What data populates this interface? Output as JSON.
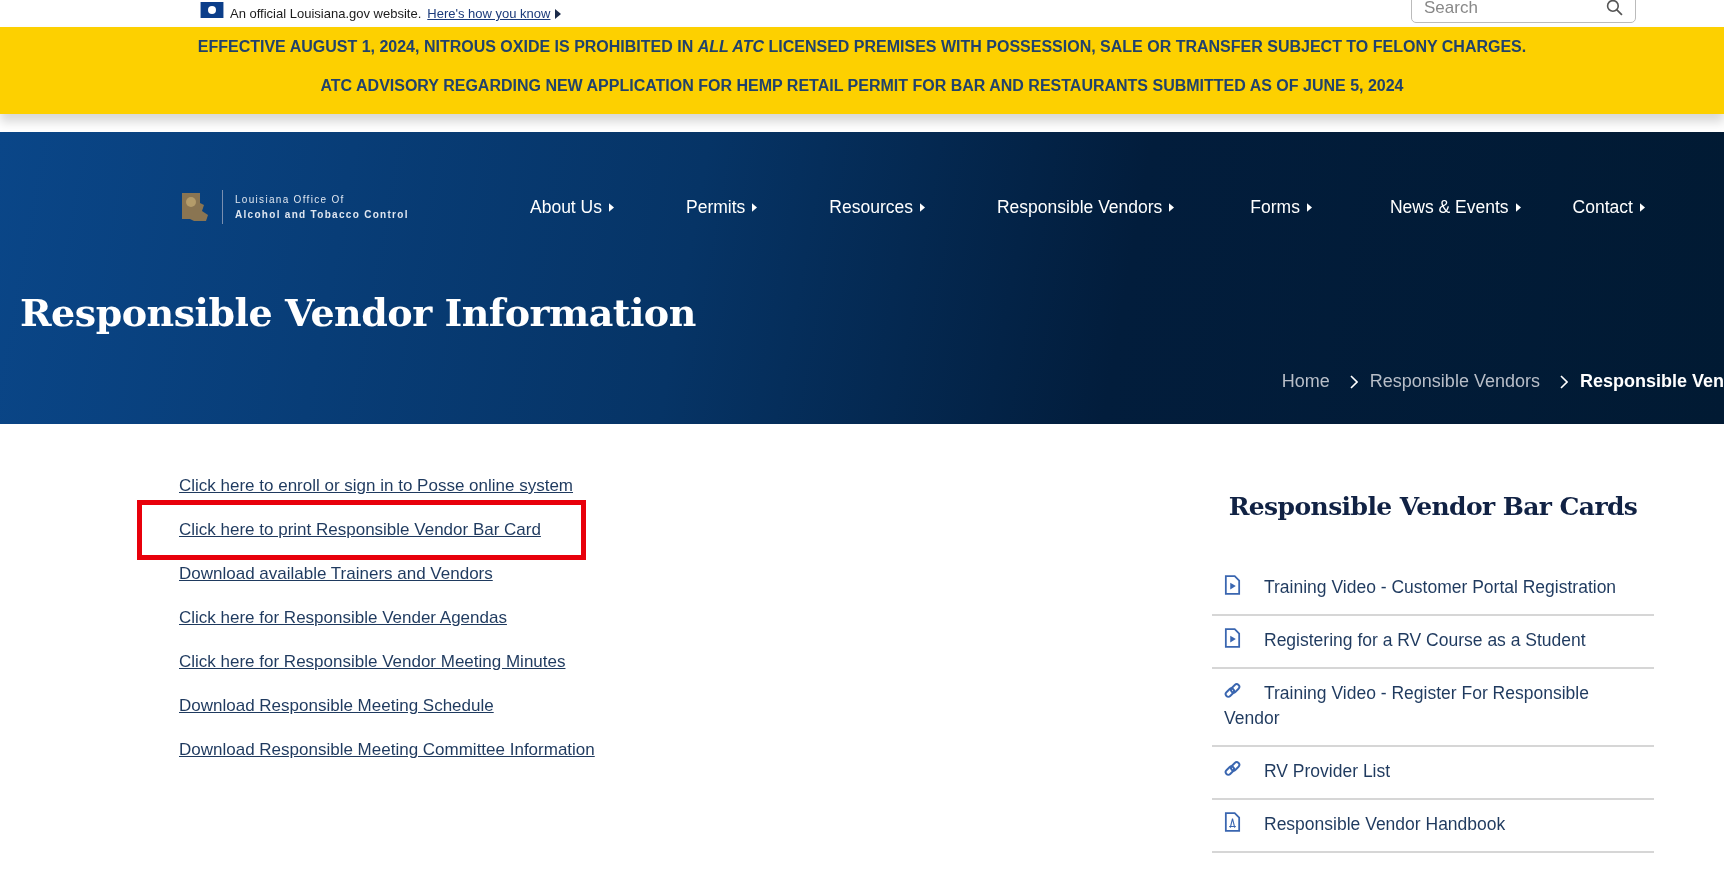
{
  "gov_bar": {
    "text": "An official Louisiana.gov website.",
    "link": "Here's how you know",
    "search": {
      "placeholder": "Search"
    }
  },
  "alerts": [
    "EFFECTIVE AUGUST 1, 2024, NITROUS OXIDE IS PROHIBITED IN *ALL ATC* LICENSED PREMISES WITH POSSESSION, SALE OR TRANSFER SUBJECT TO FELONY CHARGES.",
    "ATC ADVISORY REGARDING NEW APPLICATION FOR HEMP RETAIL PERMIT FOR BAR AND RESTAURANTS SUBMITTED AS OF JUNE 5, 2024"
  ],
  "logo": {
    "line_1": "Louisiana Office Of",
    "line_2": "Alcohol and Tobacco Control"
  },
  "nav": [
    "About Us",
    "Permits",
    "Resources",
    "Responsible Vendors",
    "Forms",
    "News & Events",
    "Contact"
  ],
  "page_title": "Responsible Vendor Information",
  "breadcrumb": [
    {
      "label": "Home",
      "current": false
    },
    {
      "label": "Responsible Vendors",
      "current": false
    },
    {
      "label": "Responsible Ven",
      "current": true
    }
  ],
  "links": [
    {
      "label": "Click here to enroll or sign in to Posse online system",
      "highlighted": false
    },
    {
      "label": "Click here to print Responsible Vendor Bar Card",
      "highlighted": true
    },
    {
      "label": "Download available Trainers and Vendors",
      "highlighted": false
    },
    {
      "label": "Click here for Responsible Vender Agendas",
      "highlighted": false
    },
    {
      "label": "Click here for Responsible Vendor Meeting Minutes",
      "highlighted": false
    },
    {
      "label": "Download Responsible Meeting Schedule",
      "highlighted": false
    },
    {
      "label": "Download Responsible Meeting Committee Information",
      "highlighted": false
    }
  ],
  "sidebar": {
    "title": "Responsible Vendor Bar Cards",
    "items": [
      {
        "kind": "video",
        "label": "Training Video - Customer Portal Registration"
      },
      {
        "kind": "video",
        "label": "Registering for a RV Course as a Student"
      },
      {
        "kind": "link",
        "label": "Training Video - Register For Responsible Vendor"
      },
      {
        "kind": "link",
        "label": "RV Provider List"
      },
      {
        "kind": "pdf",
        "label": "Responsible Vendor Handbook"
      }
    ]
  }
}
